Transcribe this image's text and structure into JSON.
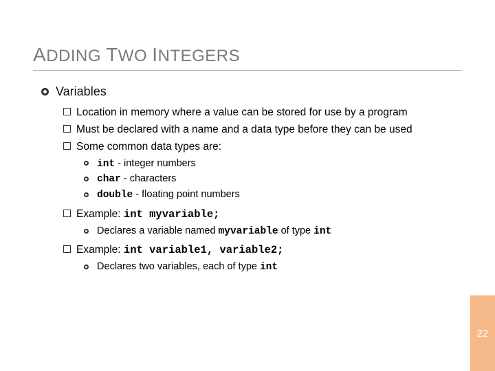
{
  "title": "ADDING TWO INTEGERS",
  "section_heading": "Variables",
  "bullets": {
    "b1": "Location in memory where a value can be stored for use by a program",
    "b2": "Must be declared with a name and a data type before they can be used",
    "b3": "Some common data types are:",
    "types": {
      "t1_code": "int",
      "t1_desc": " - integer numbers",
      "t2_code": "char",
      "t2_desc": " - characters",
      "t3_code": "double",
      "t3_desc": " - floating point numbers"
    },
    "ex1_label": "Example: ",
    "ex1_code": "int myvariable;",
    "ex1_sub_a": "Declares a variable named ",
    "ex1_sub_code1": "myvariable",
    "ex1_sub_b": " of type ",
    "ex1_sub_code2": "int",
    "ex2_label": "Example: ",
    "ex2_code": "int variable1, variable2;",
    "ex2_sub_a": "Declares two variables, each of type ",
    "ex2_sub_code": "int"
  },
  "page_number": "22"
}
